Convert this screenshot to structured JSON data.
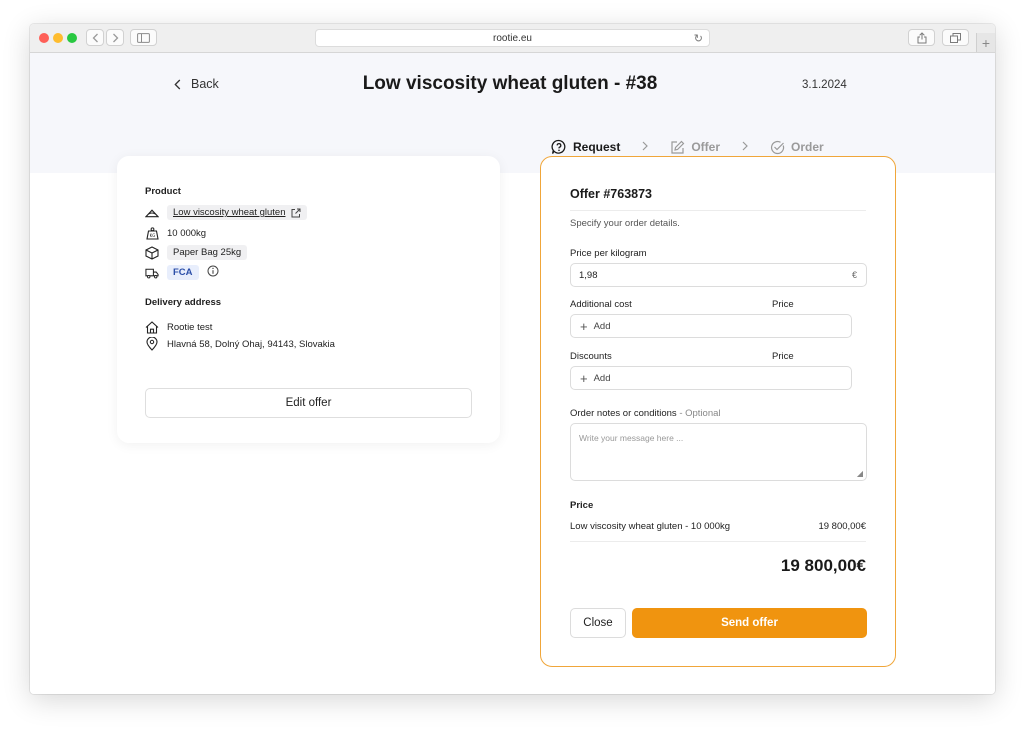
{
  "browser": {
    "url": "rootie.eu"
  },
  "header": {
    "back_label": "Back",
    "title": "Low viscosity wheat gluten - #38",
    "date": "3.1.2024"
  },
  "stepper": {
    "steps": [
      {
        "label": "Request",
        "icon": "question-bubble-icon",
        "state": "active"
      },
      {
        "label": "Offer",
        "icon": "edit-icon",
        "state": "inactive"
      },
      {
        "label": "Order",
        "icon": "check-circle-icon",
        "state": "inactive"
      }
    ]
  },
  "product": {
    "section_label": "Product",
    "name": "Low viscosity wheat gluten",
    "quantity": "10 000kg",
    "packaging": "Paper Bag 25kg",
    "incoterm": "FCA"
  },
  "delivery": {
    "section_label": "Delivery address",
    "name": "Rootie test",
    "address": "Hlavná 58, Dolný Ohaj, 94143, Slovakia"
  },
  "edit_offer_label": "Edit offer",
  "offer": {
    "title": "Offer #763873",
    "subtitle": "Specify your order details.",
    "price_per_kg_label": "Price per kilogram",
    "price_per_kg_value": "1,98",
    "currency_symbol": "€",
    "additional_cost_label": "Additional cost",
    "price_label": "Price",
    "add_label": "Add",
    "discounts_label": "Discounts",
    "notes_label": "Order notes or conditions",
    "notes_optional": "Optional",
    "notes_placeholder": "Write your message here ...",
    "price_section_label": "Price",
    "line_item_label": "Low viscosity wheat gluten - 10 000kg",
    "line_item_value": "19 800,00€",
    "total": "19 800,00€",
    "close_label": "Close",
    "send_label": "Send offer"
  },
  "colors": {
    "accent": "#f0940f",
    "card_border": "#f0a63a",
    "fca_chip": "#2b4ea8"
  }
}
